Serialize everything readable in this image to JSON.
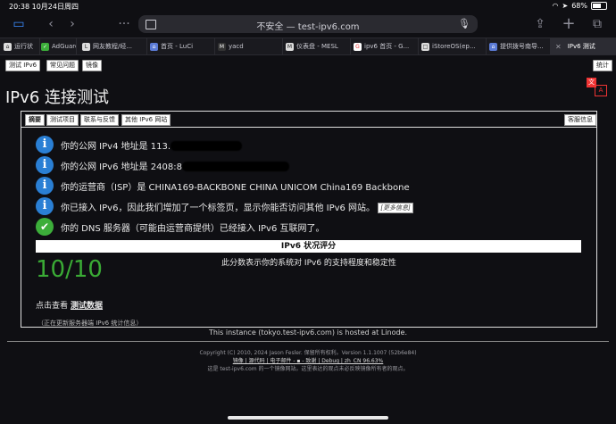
{
  "status": {
    "time": "20:38",
    "date": "10月24日周四",
    "battery": "68%"
  },
  "browser": {
    "url_prefix": "不安全 —",
    "url": "test-ipv6.com",
    "tabs": [
      {
        "label": "运行状",
        "fav": "⌂"
      },
      {
        "label": "AdGuard",
        "fav": "✓"
      },
      {
        "label": "网友教程/经...",
        "fav": "L"
      },
      {
        "label": "首页 - LuCi",
        "fav": "⌂"
      },
      {
        "label": "yacd",
        "fav": "M"
      },
      {
        "label": "仪表盘 - MESL",
        "fav": "M"
      },
      {
        "label": "ipv6 首页 - G...",
        "fav": "G"
      },
      {
        "label": "iStoreOS(ep...",
        "fav": "□"
      },
      {
        "label": "提供拨号南导...",
        "fav": "⌂"
      },
      {
        "label": "IPv6 测试",
        "fav": "✕"
      }
    ]
  },
  "nav": {
    "tabs": [
      "测试 IPv6",
      "常见问题",
      "镜像"
    ],
    "stats": "统计"
  },
  "page": {
    "title": "IPv6 连接测试",
    "subtabs": [
      "摘要",
      "测试项目",
      "联系与反馈",
      "其他 IPv6 网站"
    ],
    "admin": "客服信息",
    "rows": [
      {
        "text": "你的公网 IPv4 地址是 113."
      },
      {
        "text": "你的公网 IPv6 地址是 2408:8"
      },
      {
        "text": "你的运营商（ISP）是 CHINA169-BACKBONE CHINA UNICOM China169 Backbone"
      },
      {
        "text": "你已接入 IPv6，因此我们增加了一个标签页，显示你能否访问其他 IPv6 网站。",
        "more": "[更多信息]"
      },
      {
        "text": "你的 DNS 服务器（可能由运营商提供）已经接入 IPv6 互联网了。"
      }
    ],
    "score_title": "IPv6 状况评分",
    "score": "10/10",
    "score_desc": "此分数表示你的系统对 IPv6 的支持程度和稳定性",
    "testdata_prefix": "点击查看",
    "testdata_link": "测试数据",
    "updating": "（正在更新服务器端 IPv6 统计信息）"
  },
  "footer": {
    "hosted": "This instance (tokyo.test-ipv6.com) is hosted at Linode.",
    "copyright": "Copyright (C) 2010, 2024 Jason Fesler. 保留所有权利。Version 1.1.1007 (52b6e84)",
    "links": "镜像 | 源代码 | 电子邮件 - ▪ - 致谢 | Debug | zh_CN 96.63%",
    "note": "这是 test-ipv6.com 的一个镜像网站。这里表达的观点未必反映镜像所有者的观点。"
  }
}
